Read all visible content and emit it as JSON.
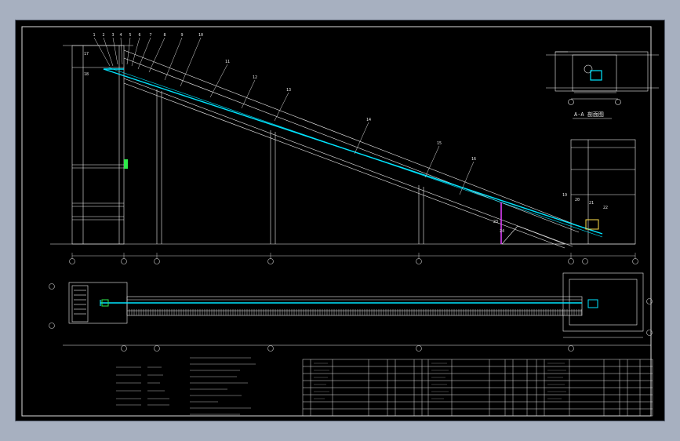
{
  "drawing": {
    "section_title": "A-A 剖面图",
    "table_header_symbols": [
      "序号",
      "代号",
      "名称",
      "数量",
      "材料",
      "备注"
    ]
  },
  "balloon_numbers": [
    "1",
    "2",
    "3",
    "4",
    "5",
    "6",
    "7",
    "8",
    "9",
    "10",
    "11",
    "12",
    "13",
    "14",
    "15",
    "16",
    "17",
    "18",
    "19",
    "20",
    "21",
    "22",
    "23",
    "24"
  ],
  "axis_labels": [
    "①",
    "②",
    "③",
    "④",
    "⑤",
    "⑥",
    "⑦",
    "⑧",
    "⑨"
  ],
  "colors": {
    "background": "#000000",
    "lines": "#ffffff",
    "belt": "#00e5ff",
    "accent_green": "#2ee84a",
    "accent_magenta": "#e040fb",
    "accent_yellow": "#ffe14a"
  }
}
